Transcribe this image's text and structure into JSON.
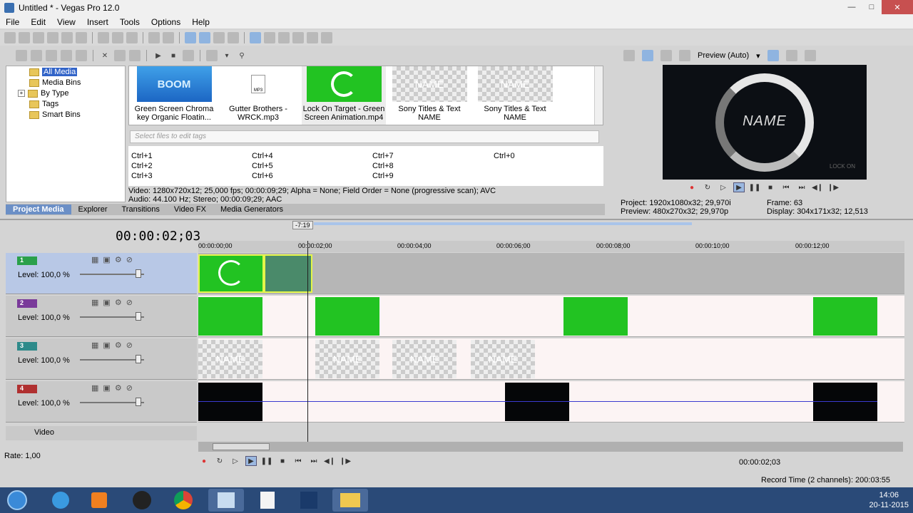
{
  "window": {
    "title": "Untitled * - Vegas Pro 12.0"
  },
  "menu": [
    "File",
    "Edit",
    "View",
    "Insert",
    "Tools",
    "Options",
    "Help"
  ],
  "tree": {
    "items": [
      "All Media",
      "Media Bins",
      "By Type",
      "Tags",
      "Smart Bins"
    ]
  },
  "media": [
    {
      "label": "Green Screen Chroma key Organic Floatin..."
    },
    {
      "label": "Gutter Brothers - WRCK.mp3"
    },
    {
      "label": "Lock On Target - Green Screen Animation.mp4"
    },
    {
      "label": "Sony Titles & Text NAME"
    },
    {
      "label": "Sony Titles & Text NAME"
    }
  ],
  "media_thumb_text": {
    "boom": "BOOM",
    "mp3": "MP3",
    "name": "NAME"
  },
  "tags_placeholder": "Select files to edit tags",
  "tag_shortcuts": [
    "Ctrl+1",
    "Ctrl+4",
    "Ctrl+7",
    "Ctrl+0",
    "Ctrl+2",
    "Ctrl+5",
    "Ctrl+8",
    "Ctrl+3",
    "Ctrl+6",
    "Ctrl+9"
  ],
  "media_info": {
    "video": "Video: 1280x720x12; 25,000 fps; 00:00:09;29; Alpha = None; Field Order = None (progressive scan); AVC",
    "audio": "Audio: 44.100 Hz; Stereo; 00:00:09;29; AAC"
  },
  "pm_tabs": [
    "Project Media",
    "Explorer",
    "Transitions",
    "Video FX",
    "Media Generators"
  ],
  "preview": {
    "mode": "Preview (Auto)",
    "overlay_text": "NAME",
    "overlay_small": "LOCK ON",
    "project": "1920x1080x32; 29,970i",
    "preview": "480x270x32; 29,970p",
    "frame": "63",
    "display": "304x171x32; 12,513",
    "project_label": "Project:",
    "preview_label": "Preview:",
    "frame_label": "Frame:",
    "display_label": "Display:"
  },
  "timeline": {
    "timecode": "00:00:02;03",
    "marker": "-7:19",
    "ruler": [
      "00:00:00;00",
      "00:00:02;00",
      "00:00:04;00",
      "00:00:06;00",
      "00:00:08;00",
      "00:00:10;00",
      "00:00:12;00"
    ],
    "tracks": [
      {
        "num": "1",
        "level": "Level: 100,0 %",
        "color": "#2aa04a"
      },
      {
        "num": "2",
        "level": "Level: 100,0 %",
        "color": "#7a3a9a"
      },
      {
        "num": "3",
        "level": "Level: 100,0 %",
        "color": "#2e8a8a"
      },
      {
        "num": "4",
        "level": "Level: 100,0 %",
        "color": "#b03030"
      }
    ],
    "video_bus": "Video",
    "rate": "Rate: 1,00",
    "cursor_time": "00:00:02;03",
    "record_time": "Record Time (2 channels): 200:03:55"
  },
  "clock": {
    "time": "14:06",
    "date": "20-11-2015"
  }
}
